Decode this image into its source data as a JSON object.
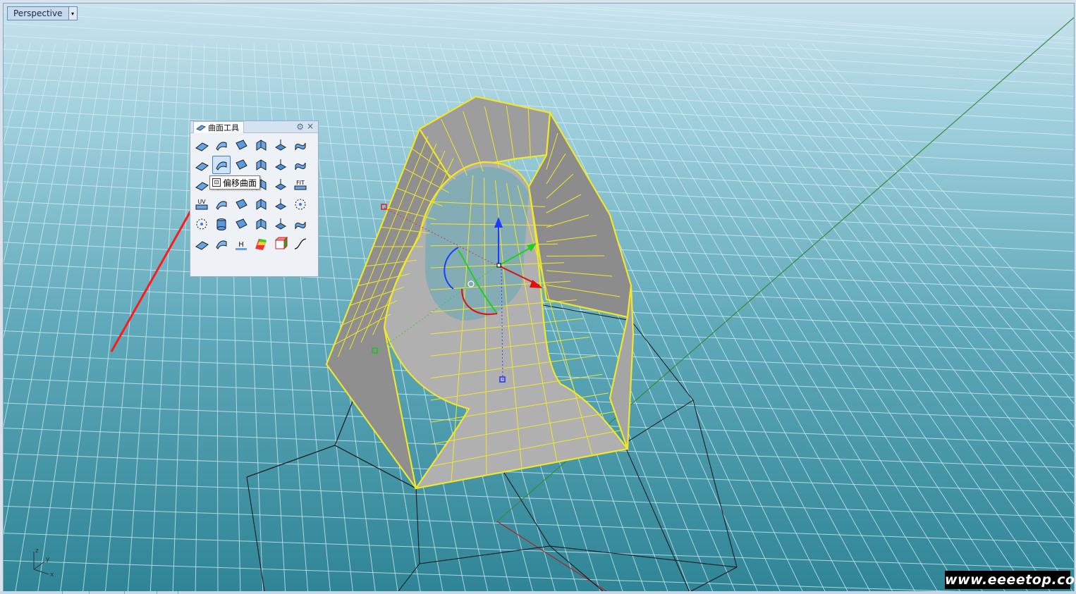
{
  "viewport": {
    "name": "Perspective",
    "menu_arrow": "▾"
  },
  "panel": {
    "title": "曲面工具",
    "settings_icon": "gear-icon",
    "close_icon": "close-icon",
    "tools": [
      [
        "surface-from-points-icon",
        "edge-curves-icon",
        "planar-curves-icon",
        "loft-icon",
        "extrude-icon",
        "sweep-icon"
      ],
      [
        "fillet-surface-icon",
        "offset-surface-icon",
        "blend-surface-icon",
        "chamfer-surface-icon",
        "extend-surface-icon",
        "connect-surfaces-icon"
      ],
      [
        "merge-surface-icon",
        "match-surface-icon",
        "rebuild-icon",
        "shrink-icon",
        "untrim-icon",
        "fit-icon"
      ],
      [
        "uvcrv-icon",
        "edit-surface-icon",
        "patch-icon",
        "network-icon",
        "unroll-icon",
        "points-icon"
      ],
      [
        "sphere-points-icon",
        "cylinder-icon",
        "drape-icon",
        "heightfield-icon",
        "flow-icon",
        "split-icon"
      ],
      [
        "split-wall-icon",
        "surface-analysis-icon",
        "text-surface-icon",
        "zebra-icon",
        "box-edit-icon",
        "curve-icon"
      ]
    ],
    "active_tool": "offset-surface-icon",
    "fit_label": "FIT",
    "uv_label": "UV"
  },
  "tooltip": {
    "text": "偏移曲面"
  },
  "axis_labels": {
    "z": "z",
    "y": "y",
    "x": "x"
  },
  "watermark": "www.eeeetop.com",
  "colors": {
    "surface_edge": "#f2e62a",
    "surface_fill": "#9a9a9a",
    "annotation_arrow": "#ff1a1a",
    "gizmo_x": "#e01010",
    "gizmo_y": "#20d020",
    "gizmo_z": "#1b3cff"
  }
}
